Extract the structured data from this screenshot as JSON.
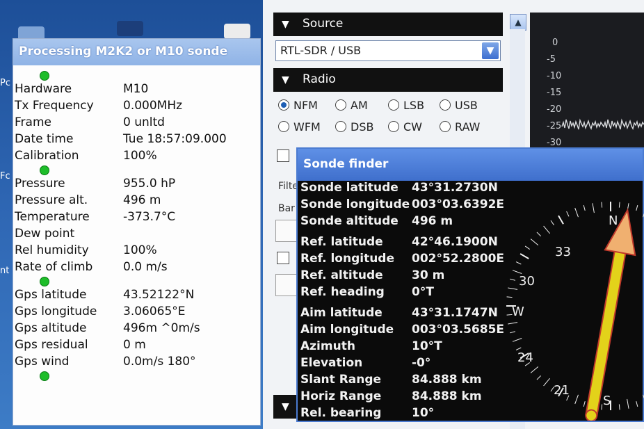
{
  "desktop": {
    "labels": [
      "Pc",
      "Fc",
      "nt"
    ]
  },
  "processing": {
    "title": "Processing M2K2 or M10 sonde",
    "status_color": "#1ebd2a",
    "group1": [
      {
        "key": "Hardware",
        "value": "M10"
      },
      {
        "key": "Tx Frequency",
        "value": "0.000MHz"
      },
      {
        "key": "Frame",
        "value": "0 unltd"
      },
      {
        "key": "Date time",
        "value": "Tue 18:57:09.000"
      },
      {
        "key": "Calibration",
        "value": "100%"
      }
    ],
    "group2": [
      {
        "key": "Pressure",
        "value": "955.0 hP"
      },
      {
        "key": "Pressure alt.",
        "value": "496 m"
      },
      {
        "key": "Temperature",
        "value": "-373.7°C"
      },
      {
        "key": "Dew point",
        "value": ""
      },
      {
        "key": "Rel humidity",
        "value": "100%"
      },
      {
        "key": "Rate of climb",
        "value": "0.0 m/s"
      }
    ],
    "group3": [
      {
        "key": "Gps latitude",
        "value": "43.52122°N"
      },
      {
        "key": "Gps longitude",
        "value": "3.06065°E"
      },
      {
        "key": "Gps altitude",
        "value": "496m ^0m/s"
      },
      {
        "key": "Gps residual",
        "value": "0 m"
      },
      {
        "key": "Gps wind",
        "value": "0.0m/s 180°"
      }
    ]
  },
  "app": {
    "source_header": "Source",
    "source_value": "RTL-SDR / USB",
    "radio_header": "Radio",
    "modes_row1": [
      "NFM",
      "AM",
      "LSB",
      "USB"
    ],
    "modes_row2": [
      "WFM",
      "DSB",
      "CW",
      "RAW"
    ],
    "selected_mode": "NFM",
    "filter_label": "Filte",
    "bandwidth_label": "Bar",
    "spectrum_ticks": [
      "0",
      "-5",
      "-10",
      "-15",
      "-20",
      "-25",
      "-30"
    ]
  },
  "finder": {
    "title": "Sonde finder",
    "sonde": [
      {
        "key": "Sonde latitude",
        "value": "43°31.2730N"
      },
      {
        "key": "Sonde longitude",
        "value": "003°03.6392E"
      },
      {
        "key": "Sonde altitude",
        "value": "496 m"
      }
    ],
    "ref": [
      {
        "key": "Ref. latitude",
        "value": "42°46.1900N"
      },
      {
        "key": "Ref. longitude",
        "value": "002°52.2800E"
      },
      {
        "key": "Ref. altitude",
        "value": "30 m"
      },
      {
        "key": "Ref. heading",
        "value": "0°T"
      }
    ],
    "aim": [
      {
        "key": "Aim latitude",
        "value": "43°31.1747N"
      },
      {
        "key": "Aim longitude",
        "value": "003°03.5685E"
      },
      {
        "key": "Azimuth",
        "value": "10°T"
      },
      {
        "key": "Elevation",
        "value": "-0°"
      },
      {
        "key": "Slant Range",
        "value": "84.888 km"
      },
      {
        "key": "Horiz Range",
        "value": "84.888 km"
      },
      {
        "key": "Rel. bearing",
        "value": "10°"
      }
    ],
    "compass": {
      "north_label": "N",
      "south_label": "S",
      "west_label": "W",
      "dial_labels": [
        "33",
        "30",
        "24",
        "21"
      ],
      "bearing_deg": 10,
      "arrow_fill": "#e3d21a",
      "arrow_head": "#f0b070",
      "arrow_edge": "#c0392b"
    }
  }
}
